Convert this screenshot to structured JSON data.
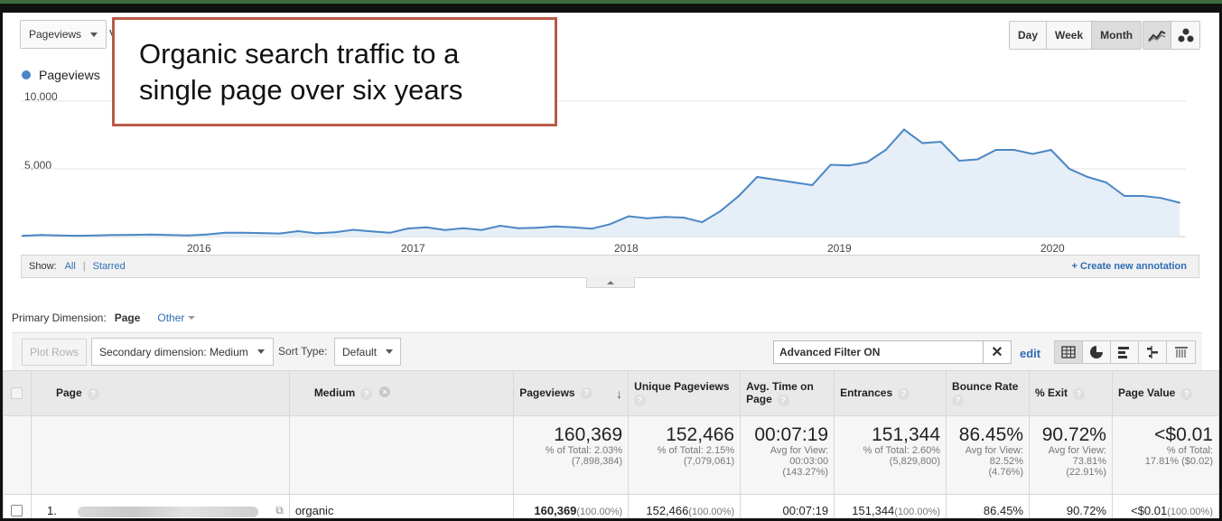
{
  "controls": {
    "metric_select": "Pageviews",
    "vs_fragment": "V",
    "range_buttons": [
      "Day",
      "Week",
      "Month"
    ],
    "active_range": "Month"
  },
  "callout_lines": [
    "Organic search traffic to a",
    "single page over six years"
  ],
  "legend": {
    "series": "Pageviews",
    "color": "#4a86c5"
  },
  "chart_data": {
    "type": "area",
    "series": [
      {
        "name": "Pageviews",
        "values": [
          60,
          110,
          90,
          60,
          80,
          110,
          130,
          150,
          110,
          90,
          150,
          280,
          290,
          260,
          230,
          400,
          240,
          320,
          500,
          380,
          280,
          600,
          690,
          480,
          620,
          490,
          800,
          620,
          650,
          750,
          680,
          580,
          920,
          1500,
          1350,
          1450,
          1400,
          1060,
          1880,
          3000,
          4400,
          4200,
          4000,
          3800,
          5300,
          5250,
          5500,
          6400,
          7900,
          6900,
          7000,
          5600,
          5700,
          6400,
          6400,
          6100,
          6400,
          5000,
          4400,
          4000,
          3000,
          3000,
          2850,
          2500
        ]
      }
    ],
    "x_tick_labels": [
      "2016",
      "2017",
      "2018",
      "2019",
      "2020"
    ],
    "y_tick_labels": [
      "10,000",
      "5,000"
    ],
    "ylim": [
      0,
      10000
    ],
    "grid": true
  },
  "annotation_bar": {
    "show_label": "Show:",
    "all": "All",
    "separator": "|",
    "starred": "Starred",
    "create": "+ Create new annotation"
  },
  "dimension": {
    "label": "Primary Dimension:",
    "value": "Page",
    "other": "Other"
  },
  "toolbar": {
    "plot_rows": "Plot Rows",
    "secondary_dimension": "Secondary dimension: Medium",
    "sort_type_label": "Sort Type:",
    "sort_type_value": "Default",
    "filter_text": "Advanced Filter ON",
    "filter_clear": "✕",
    "edit": "edit"
  },
  "table": {
    "headers": {
      "page": "Page",
      "medium": "Medium",
      "pageviews": "Pageviews",
      "unique_pageviews": "Unique Pageviews",
      "avg_time": "Avg. Time on Page",
      "entrances": "Entrances",
      "bounce_rate": "Bounce Rate",
      "exit": "% Exit",
      "page_value": "Page Value"
    },
    "totals": {
      "pageviews": {
        "value": "160,369",
        "sub1": "% of Total: 2.03%",
        "sub2": "(7,898,384)"
      },
      "unique_pageviews": {
        "value": "152,466",
        "sub1": "% of Total: 2.15%",
        "sub2": "(7,079,061)"
      },
      "avg_time": {
        "value": "00:07:19",
        "sub1": "Avg for View:",
        "sub2": "00:03:00",
        "sub3": "(143.27%)"
      },
      "entrances": {
        "value": "151,344",
        "sub1": "% of Total: 2.60%",
        "sub2": "(5,829,800)"
      },
      "bounce_rate": {
        "value": "86.45%",
        "sub1": "Avg for View:",
        "sub2": "82.52%",
        "sub3": "(4.76%)"
      },
      "exit": {
        "value": "90.72%",
        "sub1": "Avg for View:",
        "sub2": "73.81%",
        "sub3": "(22.91%)"
      },
      "page_value": {
        "value": "<$0.01",
        "sub1": "% of Total:",
        "sub2": "17.81% ($0.02)"
      }
    },
    "row": {
      "index": "1.",
      "medium": "organic",
      "pageviews": "160,369",
      "pageviews_pct": "(100.00%)",
      "unique_pageviews": "152,466",
      "unique_pct": "(100.00%)",
      "avg_time": "00:07:19",
      "entrances": "151,344",
      "entrances_pct": "(100.00%)",
      "bounce_rate": "86.45%",
      "exit": "90.72%",
      "page_value": "<$0.01",
      "page_value_pct": "(100.00%)"
    }
  }
}
